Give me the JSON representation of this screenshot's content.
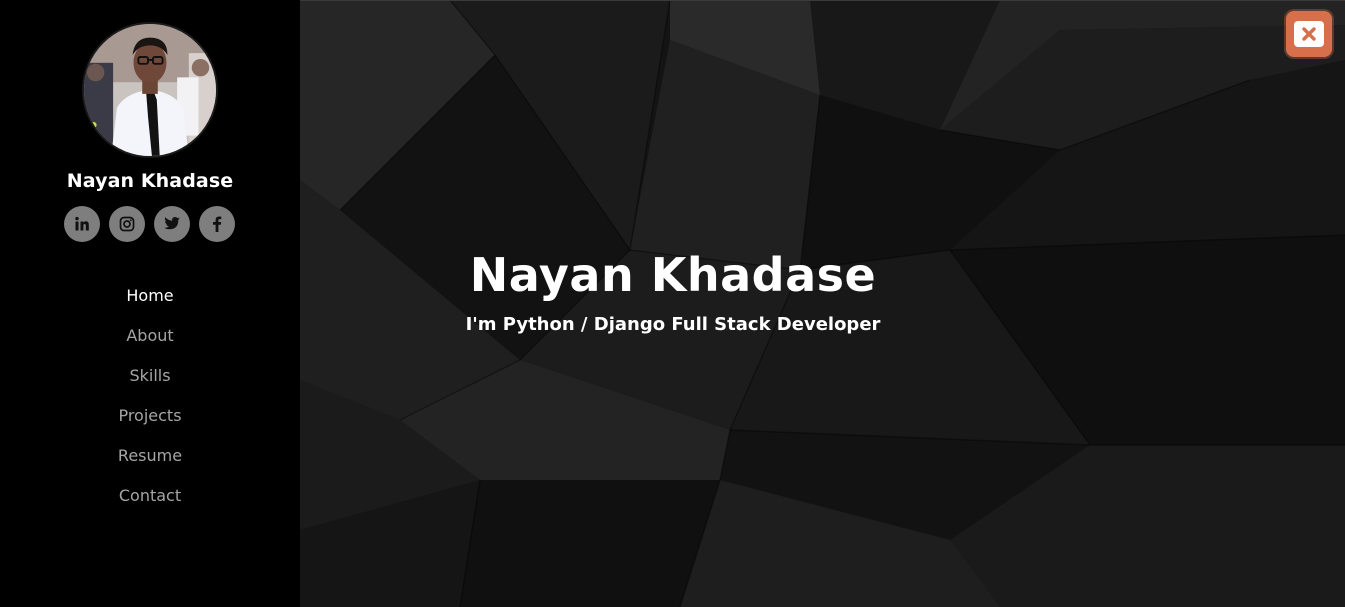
{
  "profile": {
    "name": "Nayan Khadase",
    "avatar_icon": "profile-photo"
  },
  "social": [
    {
      "icon": "linkedin-icon"
    },
    {
      "icon": "instagram-icon"
    },
    {
      "icon": "twitter-icon"
    },
    {
      "icon": "facebook-icon"
    }
  ],
  "nav": {
    "items": [
      {
        "label": "Home",
        "active": true
      },
      {
        "label": "About",
        "active": false
      },
      {
        "label": "Skills",
        "active": false
      },
      {
        "label": "Projects",
        "active": false
      },
      {
        "label": "Resume",
        "active": false
      },
      {
        "label": "Contact",
        "active": false
      }
    ]
  },
  "hero": {
    "title": "Nayan Khadase",
    "subtitle": "I'm Python / Django Full Stack Developer"
  },
  "close_button": {
    "icon": "close-icon",
    "color": "#d86f4b"
  },
  "colors": {
    "sidebar_bg": "#000000",
    "social_bg": "#7e7e7e",
    "nav_active": "#ffffff",
    "nav_inactive": "#a5a5a5"
  }
}
